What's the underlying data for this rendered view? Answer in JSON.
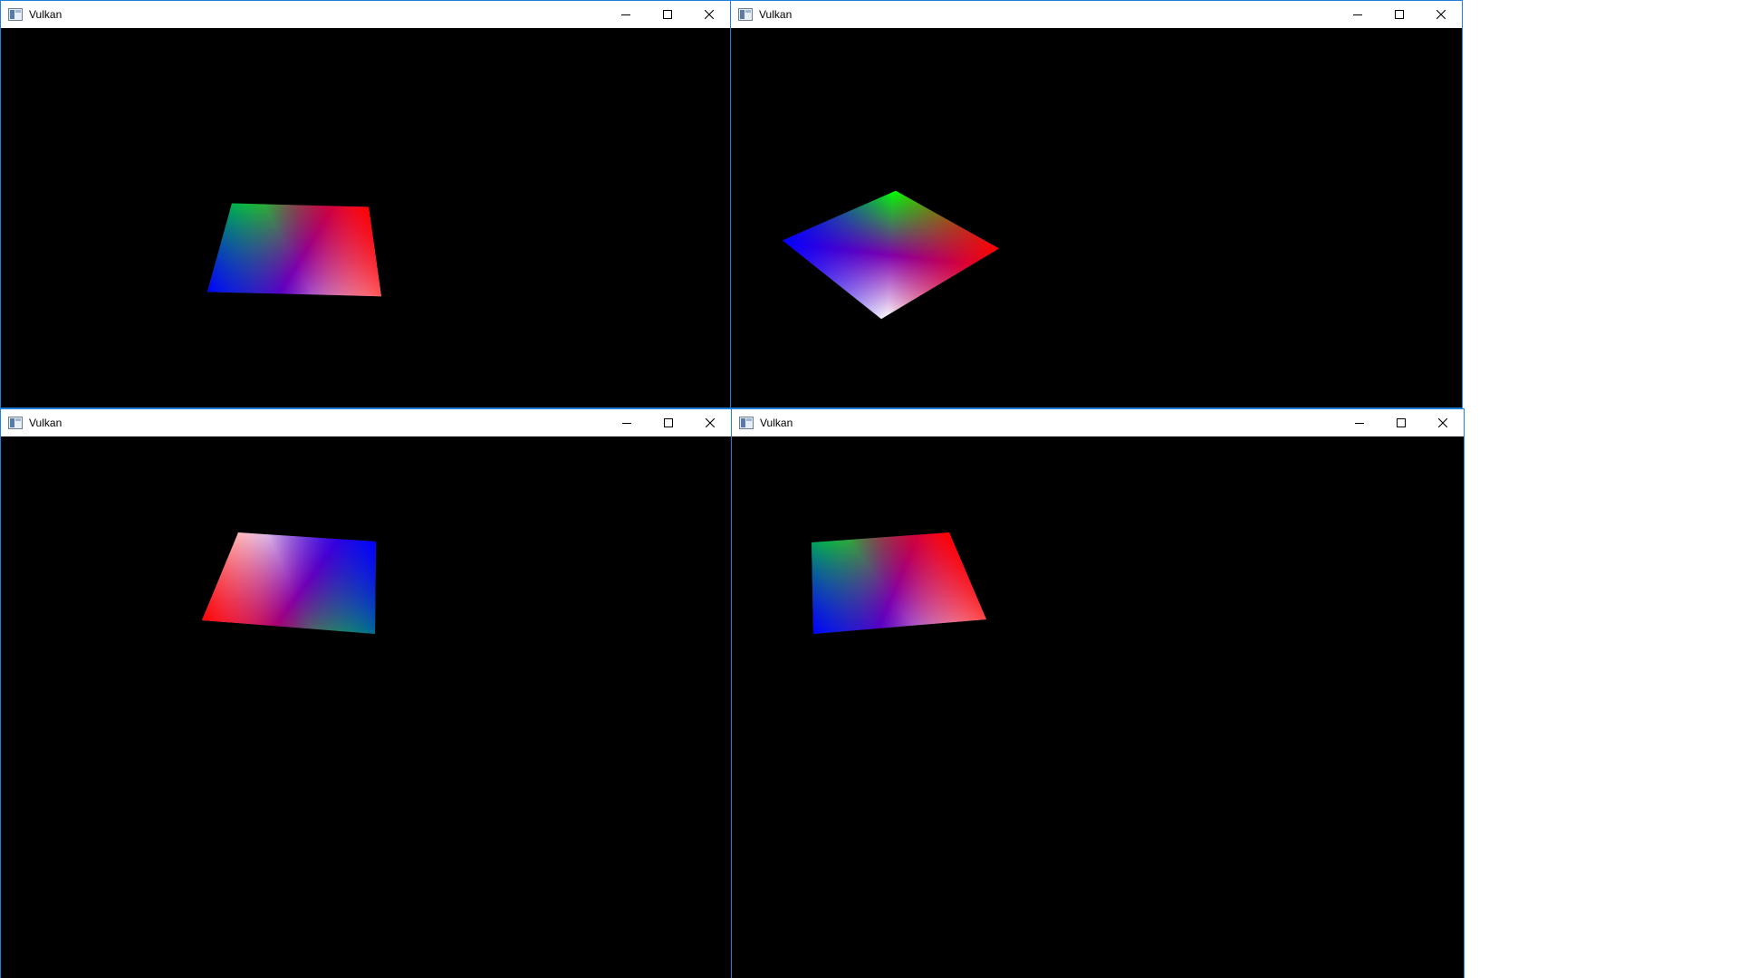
{
  "windows": [
    {
      "title": "Vulkan",
      "icon": "vulkan-app-icon",
      "controls": {
        "minimize": "minimize-icon",
        "maximize": "maximize-icon",
        "close": "close-icon"
      },
      "scene": "rotating quad"
    },
    {
      "title": "Vulkan",
      "icon": "vulkan-app-icon",
      "controls": {
        "minimize": "minimize-icon",
        "maximize": "maximize-icon",
        "close": "close-icon"
      },
      "scene": "rotating quad"
    },
    {
      "title": "Vulkan",
      "icon": "vulkan-app-icon",
      "controls": {
        "minimize": "minimize-icon",
        "maximize": "maximize-icon",
        "close": "close-icon"
      },
      "scene": "rotating quad"
    },
    {
      "title": "Vulkan",
      "icon": "vulkan-app-icon",
      "controls": {
        "minimize": "minimize-icon",
        "maximize": "maximize-icon",
        "close": "close-icon"
      },
      "scene": "rotating quad"
    }
  ],
  "colors": {
    "window_border": "#1f7fd9",
    "titlebar_bg": "#ffffff",
    "client_bg": "#000000",
    "vertex_red": "#ff0000",
    "vertex_green": "#00ff00",
    "vertex_blue": "#0000ff",
    "vertex_white": "#ffffff"
  }
}
